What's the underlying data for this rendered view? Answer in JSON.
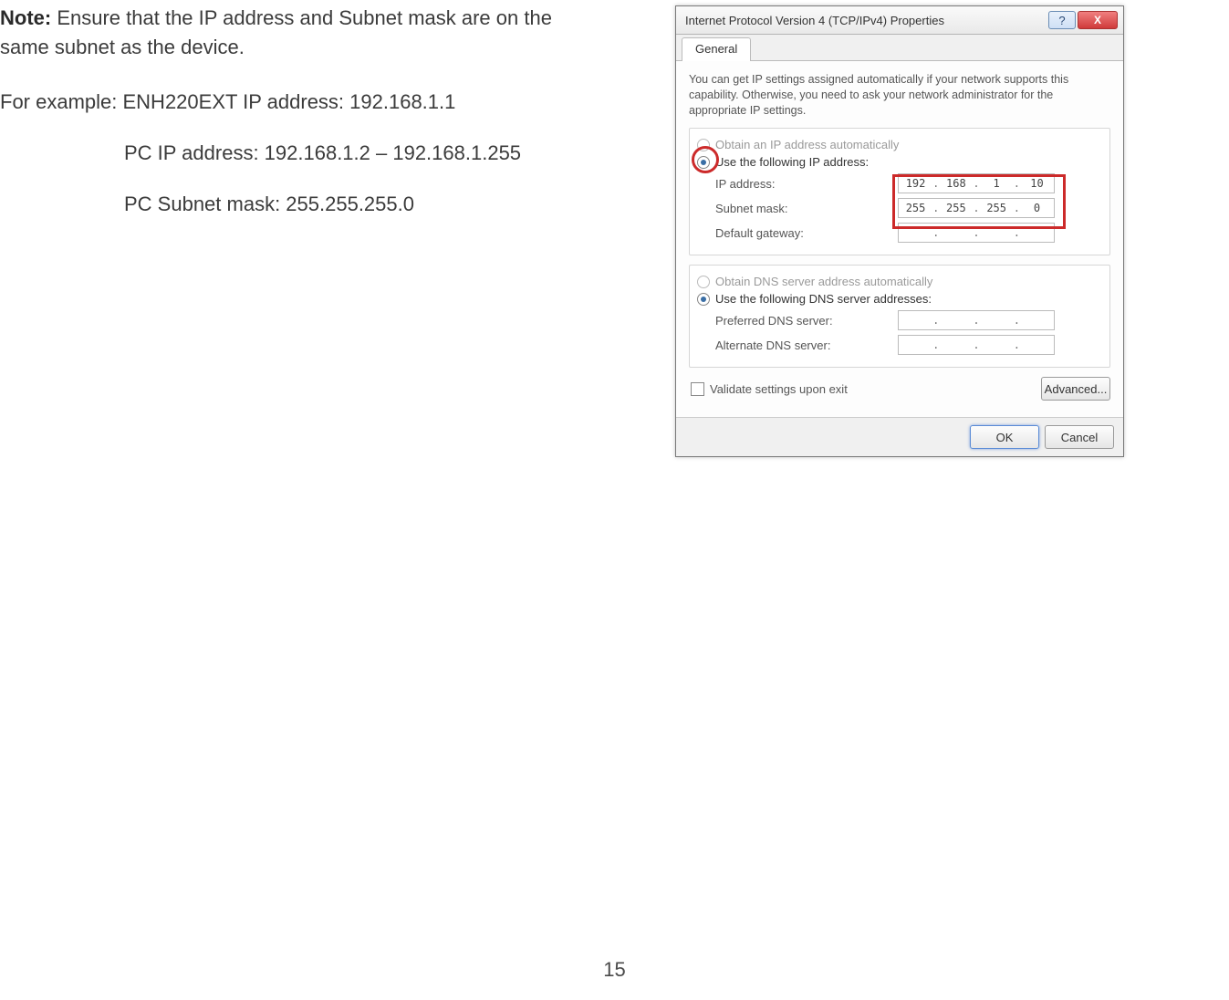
{
  "note": {
    "label": "Note:",
    "text": " Ensure that the IP address and Subnet mask are on the same subnet as the device."
  },
  "example": {
    "prefix": "For example: ",
    "line1": "ENH220EXT IP address: 192.168.1.1",
    "line2": "PC IP address: 192.168.1.2 – 192.168.1.255",
    "line3": "PC Subnet mask: 255.255.255.0"
  },
  "page_number": "15",
  "dialog": {
    "title": "Internet Protocol Version 4 (TCP/IPv4) Properties",
    "help_glyph": "?",
    "close_glyph": "X",
    "tab": "General",
    "description": "You can get IP settings assigned automatically if your network supports this capability. Otherwise, you need to ask your network administrator for the appropriate IP settings.",
    "radio_auto_ip": "Obtain an IP address automatically",
    "radio_manual_ip": "Use the following IP address:",
    "labels": {
      "ip": "IP address:",
      "subnet": "Subnet mask:",
      "gateway": "Default gateway:"
    },
    "ip": {
      "a": "192",
      "b": "168",
      "c": "1",
      "d": "10"
    },
    "subnet": {
      "a": "255",
      "b": "255",
      "c": "255",
      "d": "0"
    },
    "gateway": {
      "a": "",
      "b": "",
      "c": "",
      "d": ""
    },
    "radio_auto_dns": "Obtain DNS server address automatically",
    "radio_manual_dns": "Use the following DNS server addresses:",
    "labels_dns": {
      "preferred": "Preferred DNS server:",
      "alternate": "Alternate DNS server:"
    },
    "dns1": {
      "a": "",
      "b": "",
      "c": "",
      "d": ""
    },
    "dns2": {
      "a": "",
      "b": "",
      "c": "",
      "d": ""
    },
    "validate": "Validate settings upon exit",
    "advanced": "Advanced...",
    "ok": "OK",
    "cancel": "Cancel"
  }
}
